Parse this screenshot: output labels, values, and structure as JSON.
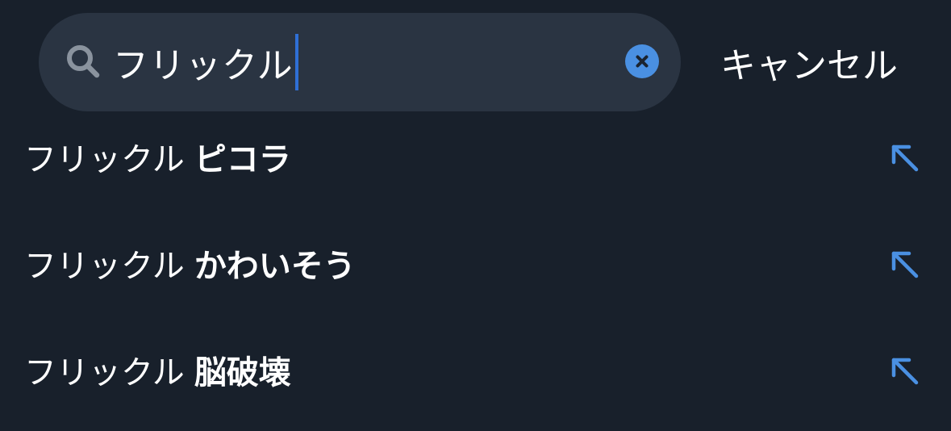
{
  "search": {
    "value": "フリックル",
    "clear_icon": "clear-circle-icon",
    "search_icon": "search-icon"
  },
  "cancel_label": "キャンセル",
  "suggestions": [
    {
      "prefix": "フリックル",
      "suffix": "ピコラ",
      "icon": "arrow-up-left-icon"
    },
    {
      "prefix": "フリックル",
      "suffix": "かわいそう",
      "icon": "arrow-up-left-icon"
    },
    {
      "prefix": "フリックル",
      "suffix": "脳破壊",
      "icon": "arrow-up-left-icon"
    }
  ],
  "colors": {
    "background": "#18202b",
    "search_field": "#2a3442",
    "accent": "#4a90e2",
    "caret": "#2f6fd6",
    "text": "#ffffff",
    "icon_muted": "#8a939e"
  }
}
